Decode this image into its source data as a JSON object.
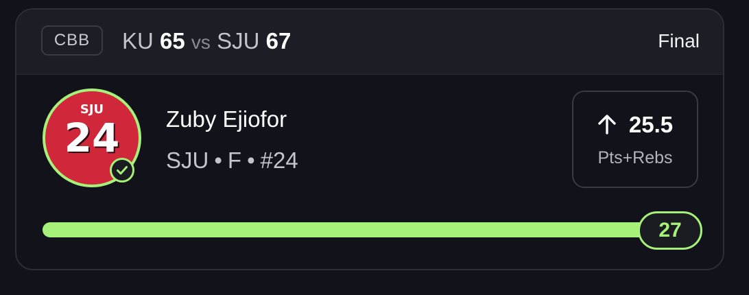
{
  "header": {
    "league": "CBB",
    "away_team": "KU",
    "away_score": "65",
    "vs": "vs",
    "home_team": "SJU",
    "home_score": "67",
    "status": "Final"
  },
  "player": {
    "name": "Zuby Ejiofor",
    "team": "SJU",
    "position": "F",
    "number": "#24",
    "separator": "•",
    "jersey_team": "SJU",
    "jersey_number": "24",
    "status_icon": "check-circle-icon"
  },
  "pick": {
    "direction": "over",
    "direction_icon": "arrow-up-icon",
    "line": "25.5",
    "stat": "Pts+Rebs"
  },
  "result": {
    "actual": "27",
    "progress_fraction": 1.0
  },
  "colors": {
    "accent": "#a6f17a",
    "background": "#12121a",
    "header_bg": "#1d1d26",
    "jersey_red": "#d0283a"
  }
}
